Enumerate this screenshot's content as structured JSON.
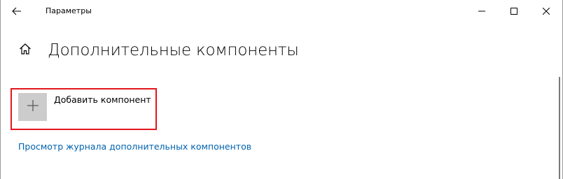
{
  "window": {
    "title": "Параметры",
    "controls": [
      "minimize",
      "maximize",
      "close"
    ]
  },
  "header": {
    "page_title": "Дополнительные компоненты"
  },
  "main": {
    "add_feature_label": "Добавить компонент",
    "history_link": "Просмотр журнала дополнительных компонентов"
  },
  "colors": {
    "highlight": "#e2161d",
    "link": "#0063b1",
    "tile": "#cccccc"
  },
  "icons": [
    "back-arrow-icon",
    "home-icon",
    "minimize-icon",
    "maximize-icon",
    "close-icon",
    "plus-icon"
  ]
}
